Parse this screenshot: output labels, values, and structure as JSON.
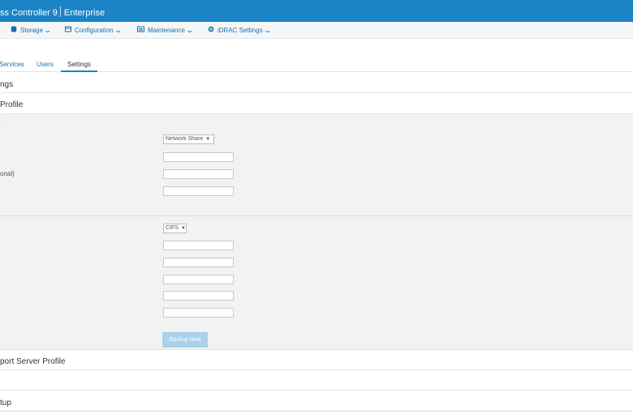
{
  "titlebar": {
    "product": "ss Controller 9",
    "edition": "Enterprise"
  },
  "menu": [
    {
      "label": "Storage"
    },
    {
      "label": "Configuration"
    },
    {
      "label": "Maintenance"
    },
    {
      "label": "iDRAC Settings"
    }
  ],
  "tabs": [
    {
      "label": "Services",
      "active": false
    },
    {
      "label": "Users",
      "active": false
    },
    {
      "label": "Settings",
      "active": true
    }
  ],
  "sections": {
    "settings_title": "ngs",
    "backup_title": "Profile",
    "export_title": "port Server Profile",
    "setup_title": "tup"
  },
  "backup_form": {
    "storage_label": "(",
    "location_select": "Network Share",
    "optional_label": "onal)",
    "share_type_select": "CIFS",
    "backup_button": "Backup Now"
  },
  "colors": {
    "brand": "#1a84c6",
    "link": "#1a6fa8",
    "button_disabled": "#a8d1ea"
  }
}
